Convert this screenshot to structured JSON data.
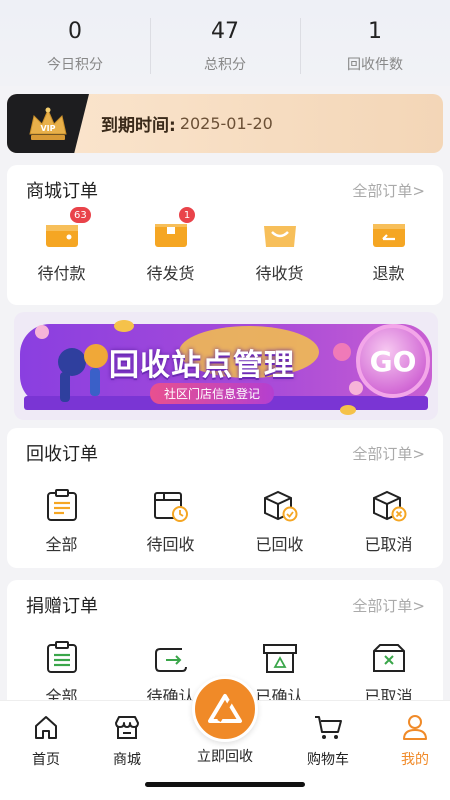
{
  "stats": [
    {
      "value": "0",
      "label": "今日积分"
    },
    {
      "value": "47",
      "label": "总积分"
    },
    {
      "value": "1",
      "label": "回收件数"
    }
  ],
  "vip": {
    "badge_icon": "vip-crown-icon",
    "label": "到期时间:",
    "date": "2025-01-20"
  },
  "mall_orders": {
    "title": "商城订单",
    "more": "全部订单>",
    "items": [
      {
        "label": "待付款",
        "icon": "wallet-icon",
        "badge": "63"
      },
      {
        "label": "待发货",
        "icon": "box-icon",
        "badge": "1"
      },
      {
        "label": "待收货",
        "icon": "package-receive-icon"
      },
      {
        "label": "退款",
        "icon": "refund-icon"
      }
    ]
  },
  "banner": {
    "title": "回收站点管理",
    "subtitle": "社区门店信息登记",
    "go": "GO"
  },
  "recycle_orders": {
    "title": "回收订单",
    "more": "全部订单>",
    "items": [
      {
        "label": "全部",
        "icon": "clipboard-icon"
      },
      {
        "label": "待回收",
        "icon": "store-clock-icon"
      },
      {
        "label": "已回收",
        "icon": "box-check-icon"
      },
      {
        "label": "已取消",
        "icon": "box-cancel-icon"
      }
    ]
  },
  "donate_orders": {
    "title": "捐赠订单",
    "more": "全部订单>",
    "items": [
      {
        "label": "全部",
        "icon": "list-icon"
      },
      {
        "label": "待确认",
        "icon": "wallet-arrow-icon"
      },
      {
        "label": "已确认",
        "icon": "box-recycle-icon"
      },
      {
        "label": "已取消",
        "icon": "box-x-icon"
      }
    ]
  },
  "tabbar": {
    "items": [
      {
        "label": "首页",
        "icon": "home-icon"
      },
      {
        "label": "商城",
        "icon": "shop-icon"
      },
      {
        "label": "立即回收",
        "icon": "recycle-icon"
      },
      {
        "label": "购物车",
        "icon": "cart-icon"
      },
      {
        "label": "我的",
        "icon": "user-icon",
        "active": true
      }
    ]
  },
  "colors": {
    "accent": "#f08a28",
    "badge": "#e9434a",
    "icon_orange": "#f5a623"
  }
}
